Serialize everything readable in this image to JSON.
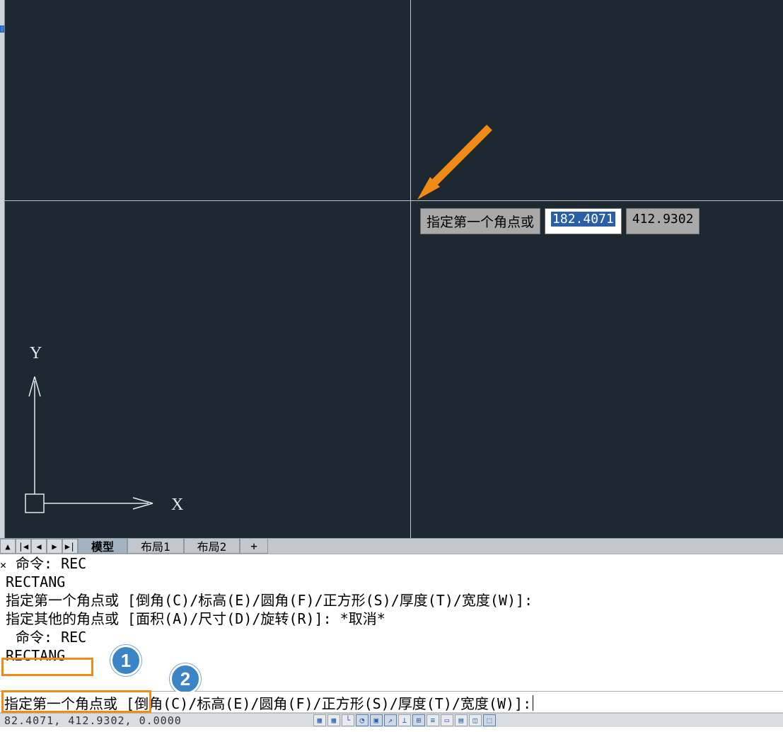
{
  "canvas": {
    "dynamic_prompt_label": "指定第一个角点或",
    "coord_x": "182.4071",
    "coord_y": "412.9302",
    "ucs_x": "X",
    "ucs_y": "Y"
  },
  "tabs": {
    "model": "模型",
    "layout1": "布局1",
    "layout2": "布局2",
    "plus": "+"
  },
  "history": {
    "l1": "命令: REC",
    "l2": "RECTANG",
    "l3": "指定第一个角点或 [倒角(C)/标高(E)/圆角(F)/正方形(S)/厚度(T)/宽度(W)]:",
    "l4": "指定其他的角点或 [面积(A)/尺寸(D)/旋转(R)]: *取消*",
    "l5": "命令: REC",
    "l6": "RECTANG"
  },
  "prompt": {
    "lead": "指定第一个角点或 ",
    "options": "[倒角(C)/标高(E)/圆角(F)/正方形(S)/厚度(T)/宽度(W)]:"
  },
  "badges": {
    "b1": "1",
    "b2": "2"
  },
  "status": {
    "coords": "82.4071, 412.9302, 0.0000"
  },
  "icons": {
    "arrow": "arrow-annotation",
    "ucs": "ucs-origin-icon",
    "nav_up": "▲",
    "nav_first": "|◀",
    "nav_prev": "◀",
    "nav_next": "▶",
    "nav_last": "▶|",
    "close": "✕"
  }
}
